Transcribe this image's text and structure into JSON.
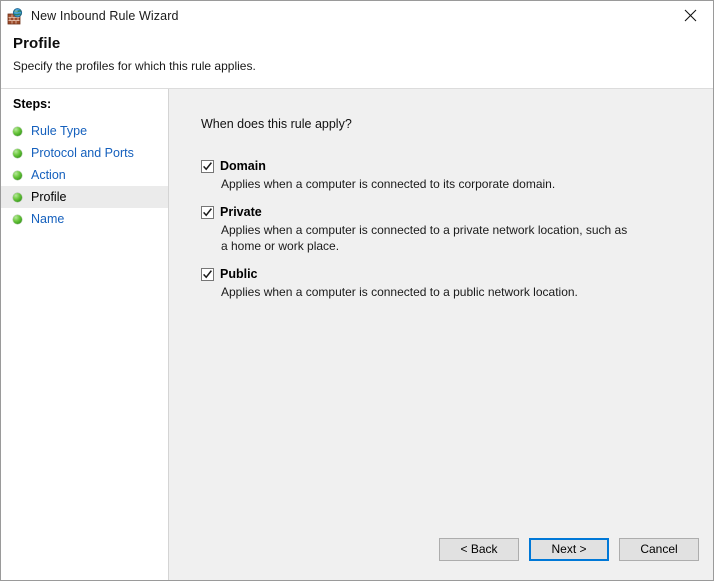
{
  "window": {
    "title": "New Inbound Rule Wizard",
    "icon": "firewall-globe-icon",
    "close_label": "✕"
  },
  "header": {
    "title": "Profile",
    "subtitle": "Specify the profiles for which this rule applies."
  },
  "sidebar": {
    "title": "Steps:",
    "items": [
      {
        "label": "Rule Type",
        "current": false
      },
      {
        "label": "Protocol and Ports",
        "current": false
      },
      {
        "label": "Action",
        "current": false
      },
      {
        "label": "Profile",
        "current": true
      },
      {
        "label": "Name",
        "current": false
      }
    ]
  },
  "main": {
    "question": "When does this rule apply?",
    "profiles": [
      {
        "name": "Domain",
        "checked": true,
        "description": "Applies when a computer is connected to its corporate domain."
      },
      {
        "name": "Private",
        "checked": true,
        "description": "Applies when a computer is connected to a private network location, such as a home or work place."
      },
      {
        "name": "Public",
        "checked": true,
        "description": "Applies when a computer is connected to a public network location."
      }
    ]
  },
  "footer": {
    "back_label": "< Back",
    "next_label": "Next >",
    "cancel_label": "Cancel"
  },
  "colors": {
    "link": "#1560bd",
    "accent": "#0078d7",
    "content_bg": "#f0f0f0",
    "sidebar_bg": "#ffffff",
    "button_bg": "#e1e1e1",
    "bullet_green": "#69c63b"
  }
}
